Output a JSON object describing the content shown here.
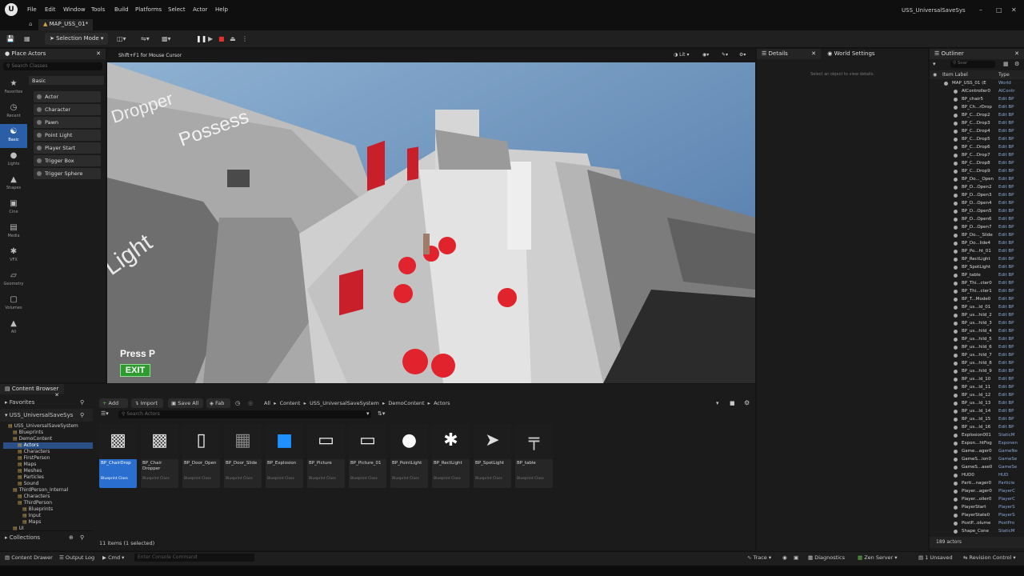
{
  "app": {
    "title": "USS_UniversalSaveSys",
    "map_tab": "MAP_USS_01*"
  },
  "menu": [
    "File",
    "Edit",
    "Window",
    "Tools",
    "Build",
    "Platforms",
    "Select",
    "Actor",
    "Help"
  ],
  "toolbar": {
    "selection_mode": "Selection Mode"
  },
  "place_actors": {
    "tab": "Place Actors",
    "search_placeholder": "Search Classes",
    "section": "Basic",
    "categories": [
      "Favorites",
      "Recent",
      "Basic",
      "Lights",
      "Shapes",
      "Cine",
      "Media",
      "VFX",
      "Geometry",
      "Volumes",
      "All"
    ],
    "items": [
      "Actor",
      "Character",
      "Pawn",
      "Point Light",
      "Player Start",
      "Trigger Box",
      "Trigger Sphere"
    ]
  },
  "viewport": {
    "hint": "Shift+F1 for Mouse Cursor",
    "lit": "Lit",
    "press": "Press  P",
    "exit": "EXIT",
    "signs": [
      "Dropper",
      "Possess",
      "Light"
    ]
  },
  "details": {
    "tab": "Details",
    "tab2": "World Settings",
    "empty": "Select an object to view details."
  },
  "outliner": {
    "tab": "Outliner",
    "search": "Sear",
    "col_label": "Item Label",
    "col_type": "Type",
    "count": "189 actors",
    "rows": [
      {
        "n": "MAP_USS_01 (E",
        "t": "World"
      },
      {
        "n": "AIController0",
        "t": "AIContr"
      },
      {
        "n": "BP_chair5",
        "t": "Edit BP"
      },
      {
        "n": "BP_Ch...rDrop",
        "t": "Edit BP"
      },
      {
        "n": "BP_C...Drop2",
        "t": "Edit BP"
      },
      {
        "n": "BP_C...Drop3",
        "t": "Edit BP"
      },
      {
        "n": "BP_C...Drop4",
        "t": "Edit BP"
      },
      {
        "n": "BP_C...Drop5",
        "t": "Edit BP"
      },
      {
        "n": "BP_C...Drop6",
        "t": "Edit BP"
      },
      {
        "n": "BP_C...Drop7",
        "t": "Edit BP"
      },
      {
        "n": "BP_C...Drop8",
        "t": "Edit BP"
      },
      {
        "n": "BP_C...Drop9",
        "t": "Edit BP"
      },
      {
        "n": "BP_Do..._Open",
        "t": "Edit BP"
      },
      {
        "n": "BP_D...Open2",
        "t": "Edit BP"
      },
      {
        "n": "BP_D...Open3",
        "t": "Edit BP"
      },
      {
        "n": "BP_D...Open4",
        "t": "Edit BP"
      },
      {
        "n": "BP_D...Open5",
        "t": "Edit BP"
      },
      {
        "n": "BP_D...Open6",
        "t": "Edit BP"
      },
      {
        "n": "BP_D...Open7",
        "t": "Edit BP"
      },
      {
        "n": "BP_Do..._Slide",
        "t": "Edit BP"
      },
      {
        "n": "BP_Do...lide4",
        "t": "Edit BP"
      },
      {
        "n": "BP_Po...ht_01",
        "t": "Edit BP"
      },
      {
        "n": "BP_RectLight",
        "t": "Edit BP"
      },
      {
        "n": "BP_SpotLight",
        "t": "Edit BP"
      },
      {
        "n": "BP_table",
        "t": "Edit BP"
      },
      {
        "n": "BP_Thi...cter0",
        "t": "Edit BP"
      },
      {
        "n": "BP_Thi...cter1",
        "t": "Edit BP"
      },
      {
        "n": "BP_T...Mode0",
        "t": "Edit BP"
      },
      {
        "n": "BP_us...ld_01",
        "t": "Edit BP"
      },
      {
        "n": "BP_us...hild_2",
        "t": "Edit BP"
      },
      {
        "n": "BP_us...hild_3",
        "t": "Edit BP"
      },
      {
        "n": "BP_us...hild_4",
        "t": "Edit BP"
      },
      {
        "n": "BP_us...hild_5",
        "t": "Edit BP"
      },
      {
        "n": "BP_us...hild_6",
        "t": "Edit BP"
      },
      {
        "n": "BP_us...hild_7",
        "t": "Edit BP"
      },
      {
        "n": "BP_us...hild_8",
        "t": "Edit BP"
      },
      {
        "n": "BP_us...hild_9",
        "t": "Edit BP"
      },
      {
        "n": "BP_us...ld_10",
        "t": "Edit BP"
      },
      {
        "n": "BP_us...ld_11",
        "t": "Edit BP"
      },
      {
        "n": "BP_us...ld_12",
        "t": "Edit BP"
      },
      {
        "n": "BP_us...ld_13",
        "t": "Edit BP"
      },
      {
        "n": "BP_us...ld_14",
        "t": "Edit BP"
      },
      {
        "n": "BP_us...ld_15",
        "t": "Edit BP"
      },
      {
        "n": "BP_us...ld_16",
        "t": "Edit BP"
      },
      {
        "n": "Explosion001",
        "t": "StaticM"
      },
      {
        "n": "Expon...htFog",
        "t": "Exponen"
      },
      {
        "n": "Game...ager0",
        "t": "GameNe"
      },
      {
        "n": "GameS...ion0",
        "t": "GameSe"
      },
      {
        "n": "GameS...ase0",
        "t": "GameSe"
      },
      {
        "n": "HUD0",
        "t": "HUD"
      },
      {
        "n": "Parti...nager0",
        "t": "Particle"
      },
      {
        "n": "Player...ager0",
        "t": "PlayerC"
      },
      {
        "n": "Player...oller0",
        "t": "PlayerC"
      },
      {
        "n": "PlayerStart",
        "t": "PlayerS"
      },
      {
        "n": "PlayerState0",
        "t": "PlayerS"
      },
      {
        "n": "PostP...olume",
        "t": "PostPro"
      },
      {
        "n": "Shape_Cone",
        "t": "StaticM"
      }
    ]
  },
  "content_browser": {
    "tab": "Content Browser",
    "favorites": "Favorites",
    "root": "USS_UniversalSaveSys",
    "collections": "Collections",
    "add": "Add",
    "import": "Import",
    "save_all": "Save All",
    "fab": "Fab",
    "search_placeholder": "Search Actors",
    "path": [
      "All",
      "Content",
      "USS_UniversalSaveSystem",
      "DemoContent",
      "Actors"
    ],
    "status": "11 items (1 selected)",
    "tree": [
      "USS_UniversalSaveSystem",
      "Blueprints",
      "DemoContent",
      "Actors",
      "Characters",
      "FirstPerson",
      "Maps",
      "Meshes",
      "Particles",
      "Sound",
      "ThirdPerson_Internal",
      "Characters",
      "ThirdPerson",
      "Blueprints",
      "Input",
      "Maps",
      "UI"
    ],
    "assets": [
      {
        "name": "BP_ChairDrop",
        "cls": "Blueprint Class"
      },
      {
        "name": "BP_Chair Dropper",
        "cls": "Blueprint Class"
      },
      {
        "name": "BP_Door_Open",
        "cls": "Blueprint Class"
      },
      {
        "name": "BP_Door_Slide",
        "cls": "Blueprint Class"
      },
      {
        "name": "BP_Explosion",
        "cls": "Blueprint Class"
      },
      {
        "name": "BP_Picture",
        "cls": "Blueprint Class"
      },
      {
        "name": "BP_Picture_01",
        "cls": "Blueprint Class"
      },
      {
        "name": "BP_PointLight",
        "cls": "Blueprint Class"
      },
      {
        "name": "BP_RectLight",
        "cls": "Blueprint Class"
      },
      {
        "name": "BP_SpotLight",
        "cls": "Blueprint Class"
      },
      {
        "name": "BP_table",
        "cls": "Blueprint Class"
      }
    ]
  },
  "statusbar": {
    "content_drawer": "Content Drawer",
    "output_log": "Output Log",
    "cmd": "Cmd",
    "console_placeholder": "Enter Console Command",
    "trace": "Trace",
    "diagnostics": "Diagnostics",
    "zen": "Zen Server",
    "unsaved": "1 Unsaved",
    "revision": "Revision Control"
  }
}
